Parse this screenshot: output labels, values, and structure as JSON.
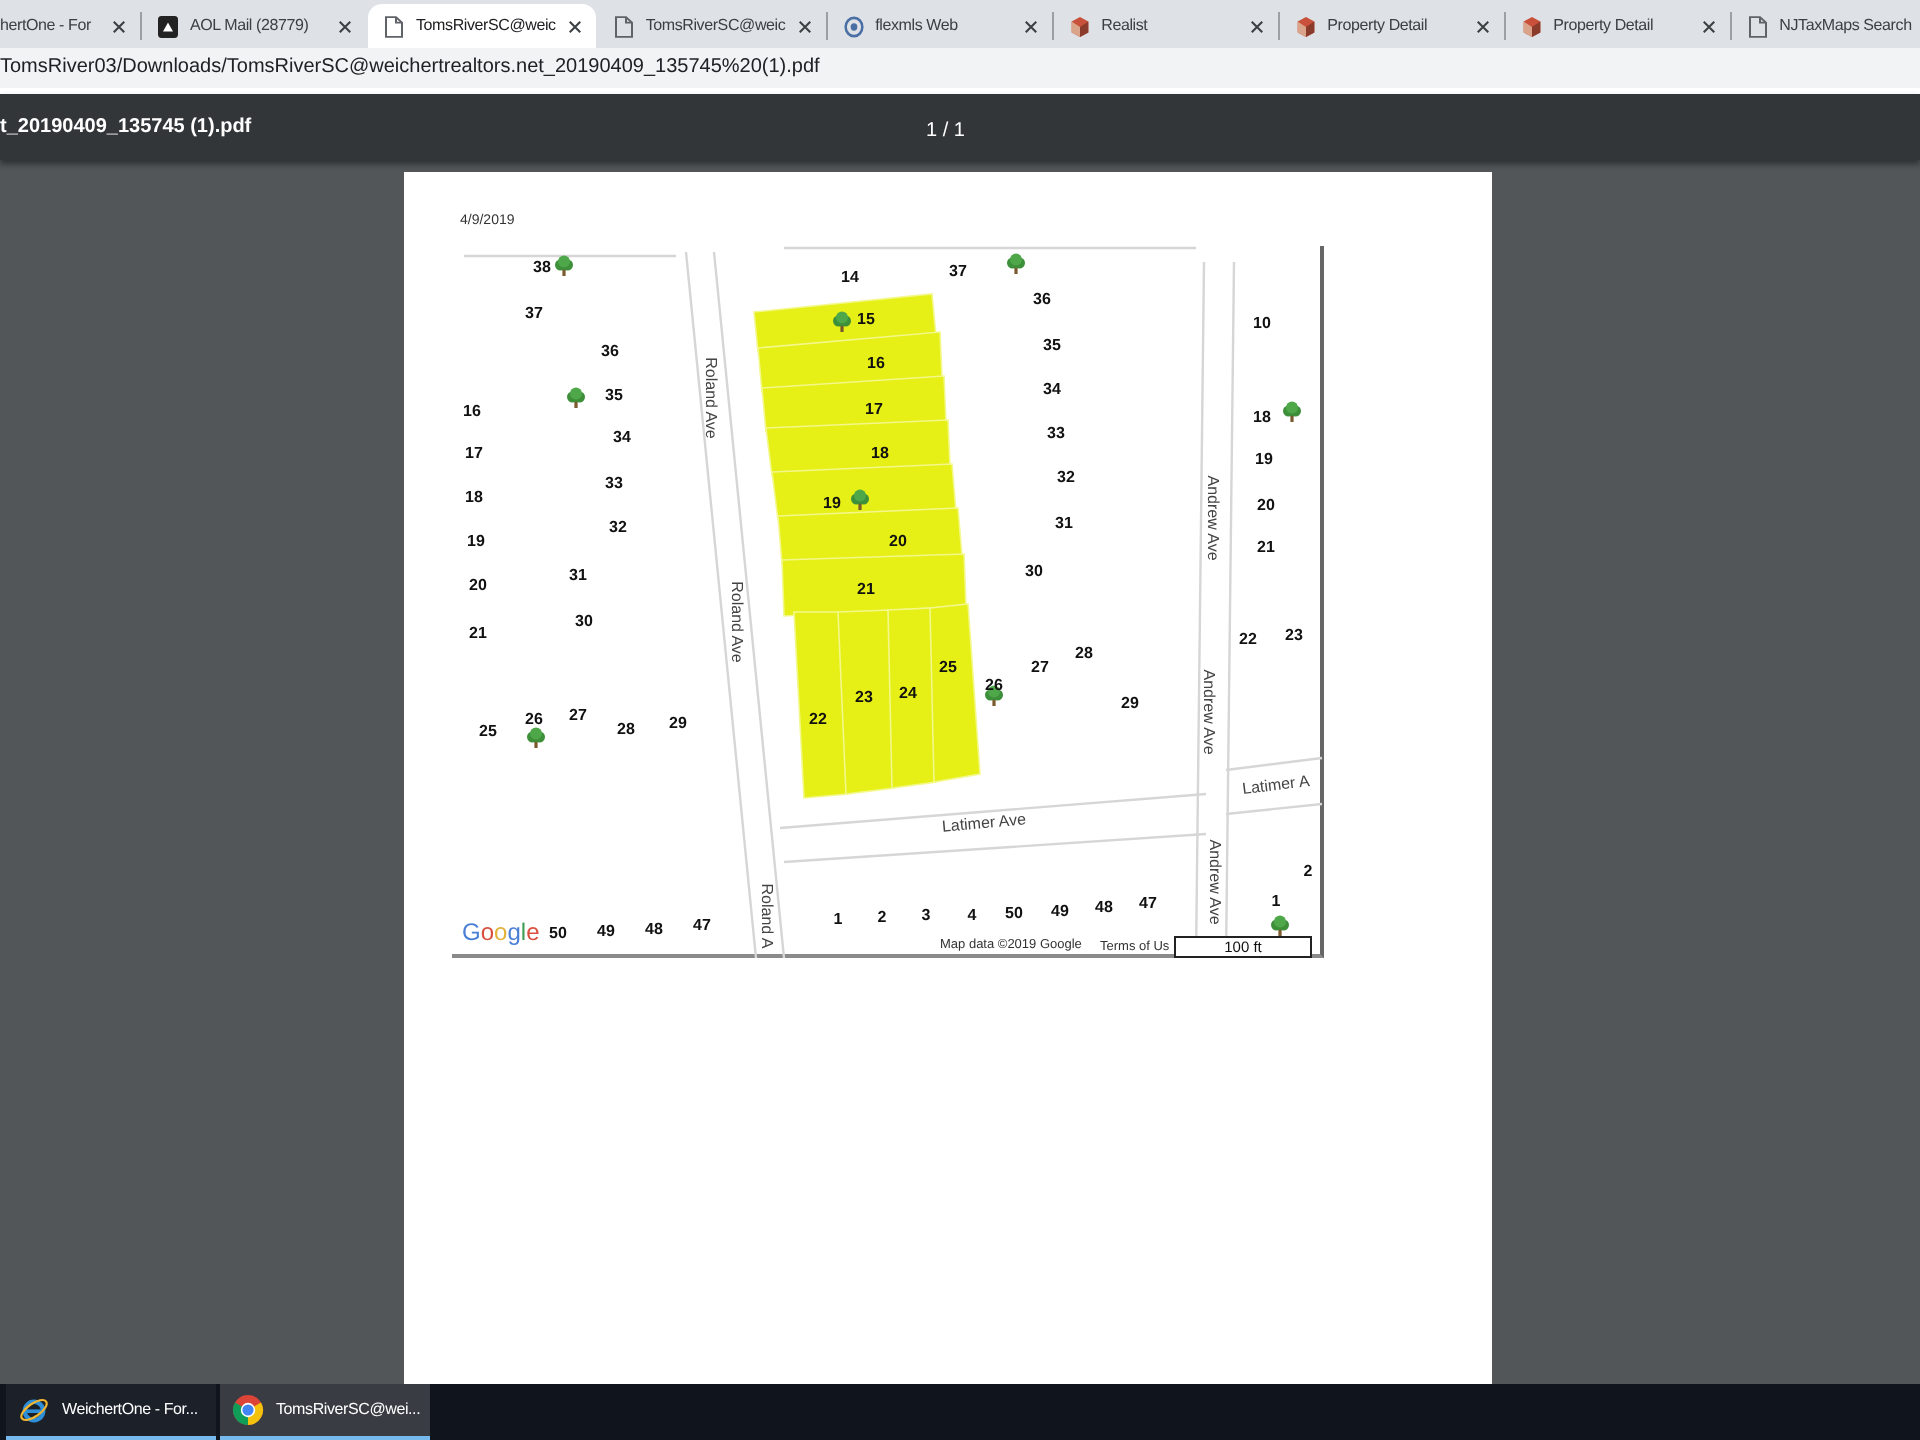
{
  "browser": {
    "tabs": [
      {
        "title": "hertOne - For",
        "kind": "none",
        "selected": false
      },
      {
        "title": "AOL Mail (28779)",
        "kind": "app",
        "selected": false
      },
      {
        "title": "TomsRiverSC@weic",
        "kind": "page",
        "selected": true
      },
      {
        "title": "TomsRiverSC@weic",
        "kind": "page",
        "selected": false
      },
      {
        "title": "flexmls Web",
        "kind": "circle",
        "selected": false
      },
      {
        "title": "Realist",
        "kind": "cube",
        "selected": false
      },
      {
        "title": "Property Detail",
        "kind": "cube",
        "selected": false
      },
      {
        "title": "Property Detail",
        "kind": "cube",
        "selected": false
      },
      {
        "title": "NJTaxMaps Search",
        "kind": "page",
        "selected": false
      }
    ],
    "address": "TomsRiver03/Downloads/TomsRiverSC@weichertrealtors.net_20190409_135745%20(1).pdf"
  },
  "pdf_viewer": {
    "file_name": "t_20190409_135745 (1).pdf",
    "page_indicator": "1 / 1",
    "page": {
      "date": "4/9/2019",
      "map": {
        "lot_numbers": [
          "38",
          "37",
          "36",
          "35",
          "16",
          "34",
          "17",
          "18",
          "33",
          "32",
          "19",
          "20",
          "31",
          "21",
          "30",
          "25",
          "26",
          "27",
          "28",
          "29",
          "14",
          "37",
          "36",
          "15",
          "35",
          "16",
          "34",
          "17",
          "33",
          "18",
          "32",
          "19",
          "31",
          "20",
          "30",
          "21",
          "28",
          "25",
          "27",
          "23",
          "24",
          "26",
          "22",
          "29",
          "10",
          "18",
          "19",
          "20",
          "21",
          "22",
          "23",
          "50",
          "49",
          "48",
          "47",
          "1",
          "2",
          "3",
          "4",
          "50",
          "49",
          "48",
          "47",
          "2",
          "1"
        ],
        "streets": [
          "Roland Ave",
          "Roland Ave",
          "Roland A",
          "Andrew Ave",
          "Andrew Ave",
          "Andrew Ave",
          "Latimer Ave",
          "Latimer A"
        ],
        "logo": "Google",
        "attribution": "Map data ©2019 Google",
        "terms": "Terms of Us",
        "scale": "100 ft"
      }
    }
  },
  "taskbar": {
    "items": [
      {
        "label": "WeichertOne - For...",
        "kind": "ring",
        "selected": false
      },
      {
        "label": "TomsRiverSC@wei...",
        "kind": "round",
        "selected": true
      }
    ]
  }
}
